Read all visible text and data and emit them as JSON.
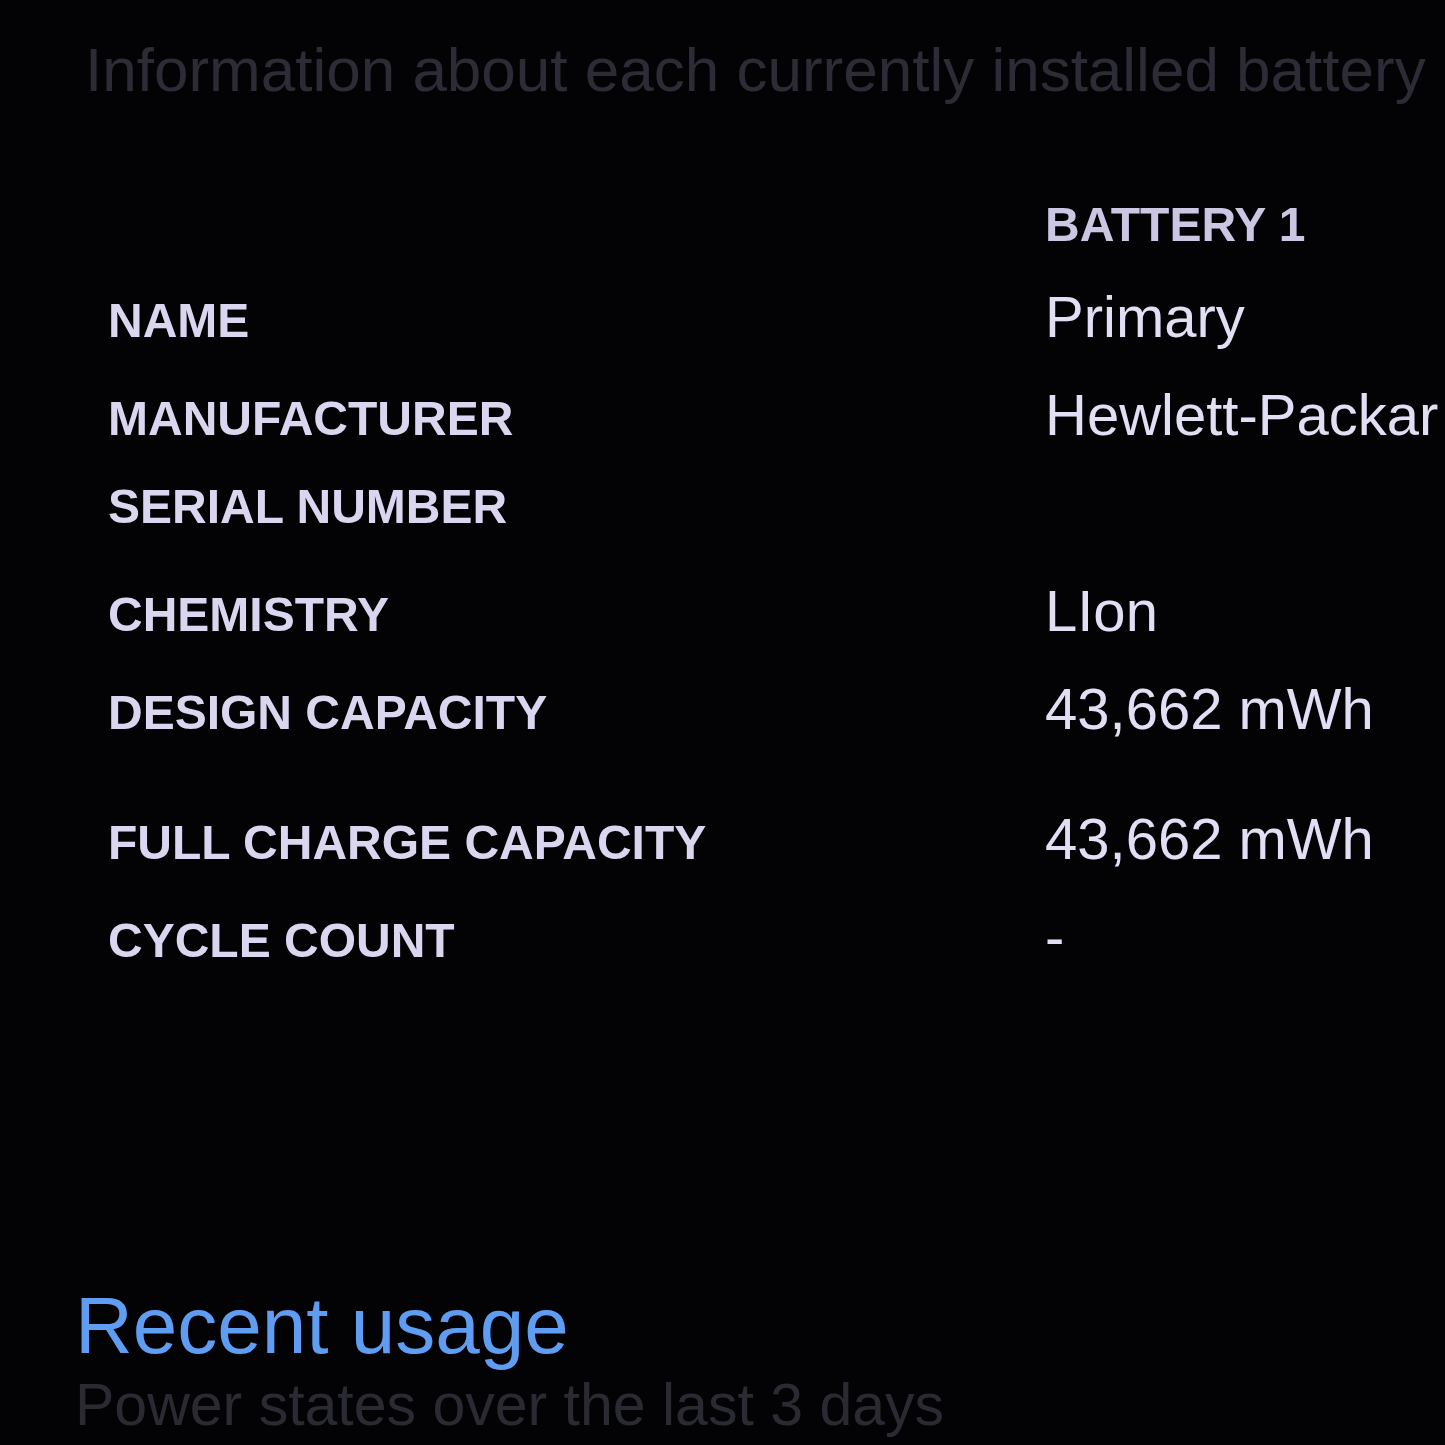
{
  "installed_batteries": {
    "description": "Information about each currently installed battery",
    "column_header": "BATTERY 1",
    "row_groups": [
      {
        "rows": [
          {
            "label": "NAME",
            "value": "Primary"
          },
          {
            "label": "MANUFACTURER",
            "value": "Hewlett-Packar"
          },
          {
            "label": "SERIAL NUMBER"
          },
          {
            "label": "CHEMISTRY",
            "value": "LIon"
          },
          {
            "label": "DESIGN CAPACITY",
            "value": "43,662 mWh"
          }
        ]
      },
      {
        "rows": [
          {
            "label": "FULL CHARGE CAPACITY",
            "value": "43,662 mWh"
          },
          {
            "label": "CYCLE COUNT",
            "value": "-"
          }
        ]
      }
    ]
  },
  "recent_usage": {
    "title": "Recent usage",
    "description": "Power states over the last 3 days"
  }
}
